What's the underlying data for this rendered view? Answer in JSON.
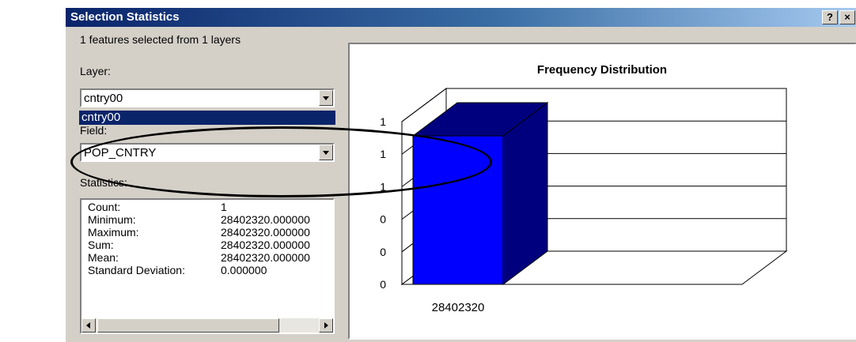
{
  "window": {
    "title": "Selection Statistics",
    "help_button": "?",
    "close_button": "×"
  },
  "summary": "1 features selected from 1 layers",
  "layer": {
    "label": "Layer:",
    "value": "cntry00",
    "dropdown_highlight": "cntry00"
  },
  "field": {
    "label": "Field:",
    "value": "POP_CNTRY"
  },
  "statistics": {
    "label": "Statistics:",
    "rows": [
      {
        "key": "Count:",
        "value": "1"
      },
      {
        "key": "Minimum:",
        "value": "28402320.000000"
      },
      {
        "key": "Maximum:",
        "value": "28402320.000000"
      },
      {
        "key": "Sum:",
        "value": "28402320.000000"
      },
      {
        "key": "Mean:",
        "value": "28402320.000000"
      },
      {
        "key": "Standard Deviation:",
        "value": "0.000000"
      }
    ]
  },
  "colors": {
    "bar_front": "#0000ff",
    "bar_side": "#00007f",
    "title_start": "#0a246a",
    "highlight": "#0a246a"
  },
  "chart_data": {
    "type": "bar",
    "title": "Frequency Distribution",
    "categories": [
      "28402320"
    ],
    "values": [
      1
    ],
    "ytick_labels": [
      "1",
      "1",
      "1",
      "0",
      "0",
      "0"
    ],
    "grid": true
  }
}
